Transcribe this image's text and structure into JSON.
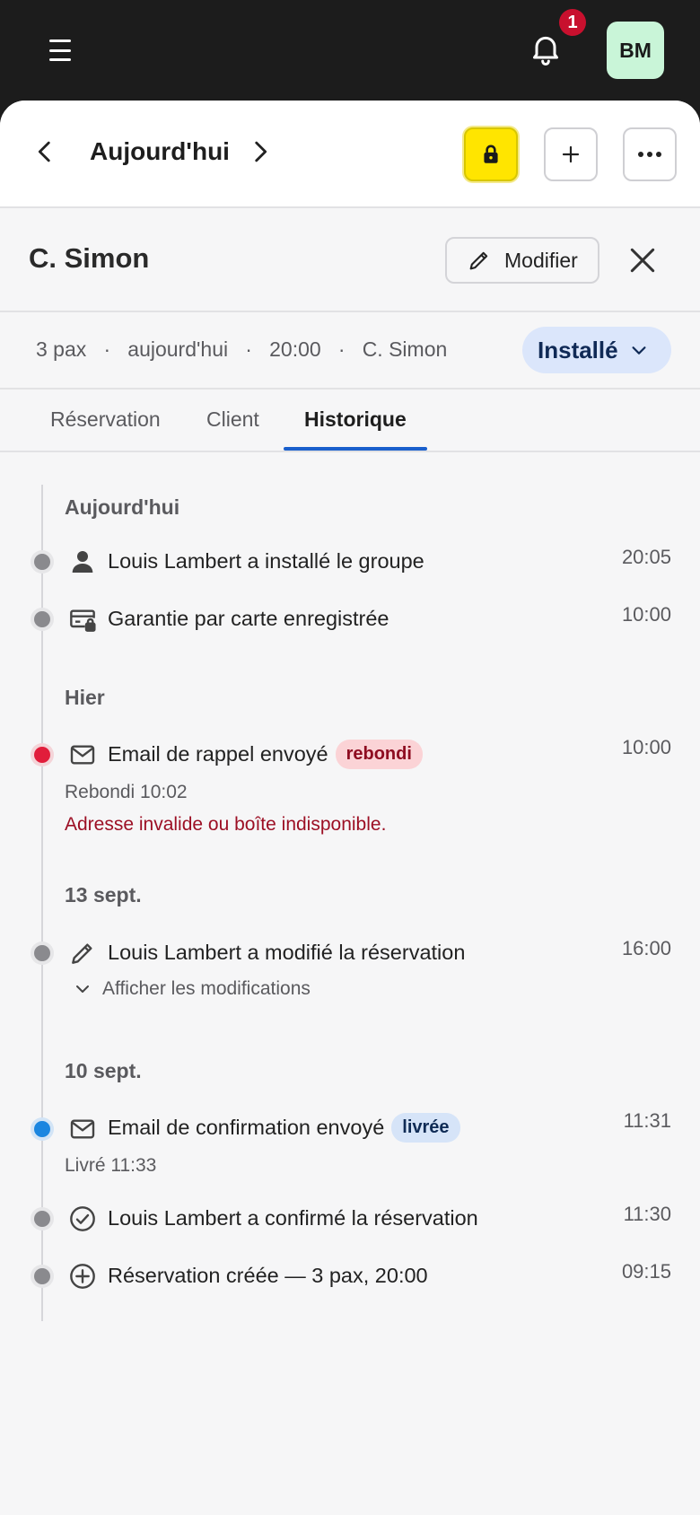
{
  "topbar": {
    "notifications_count": "1",
    "avatar_initials": "BM"
  },
  "datebar": {
    "title": "Aujourd'hui"
  },
  "guest": {
    "name": "C. Simon",
    "edit_label": "Modifier"
  },
  "info": {
    "pax": "3 pax",
    "sep": "·",
    "day": "aujourd'hui",
    "time": "20:00",
    "guest": "C. Simon",
    "status": "Installé"
  },
  "tabs": [
    {
      "label": "Réservation"
    },
    {
      "label": "Client"
    },
    {
      "label": "Historique"
    }
  ],
  "timeline": {
    "groups": [
      {
        "label": "Aujourd'hui"
      },
      {
        "label": "Hier"
      },
      {
        "label": "13 sept."
      },
      {
        "label": "10 sept."
      }
    ],
    "events": [
      {
        "text": "Louis Lambert a installé le groupe",
        "time": "20:05",
        "icon": "person-icon"
      },
      {
        "text": "Garantie par carte enregistrée",
        "time": "10:00",
        "icon": "card-lock-icon"
      },
      {
        "text": "Email de rappel envoyé",
        "time": "10:00",
        "icon": "mail-icon",
        "badge": "rebondi",
        "sub": "Rebondi 10:02",
        "error": "Adresse invalide ou boîte indisponible."
      },
      {
        "text": "Louis Lambert a modifié la réservation",
        "time": "16:00",
        "icon": "pencil-icon",
        "toggle": "Afficher les modifications"
      },
      {
        "text": "Email de confirmation envoyé",
        "time": "11:31",
        "icon": "mail-icon",
        "badge": "livrée",
        "sub": "Livré 11:33"
      },
      {
        "text": "Louis Lambert a confirmé la réservation",
        "time": "11:30",
        "icon": "check-circle-icon"
      },
      {
        "text": "Réservation créée — 3 pax, 20:00",
        "time": "09:15",
        "icon": "plus-circle-icon"
      }
    ]
  },
  "colors": {
    "accent": "#1a5fcc",
    "lock_button": "#ffe500",
    "status_pill": "#dbe6fb",
    "error_text": "#9c0f24"
  }
}
